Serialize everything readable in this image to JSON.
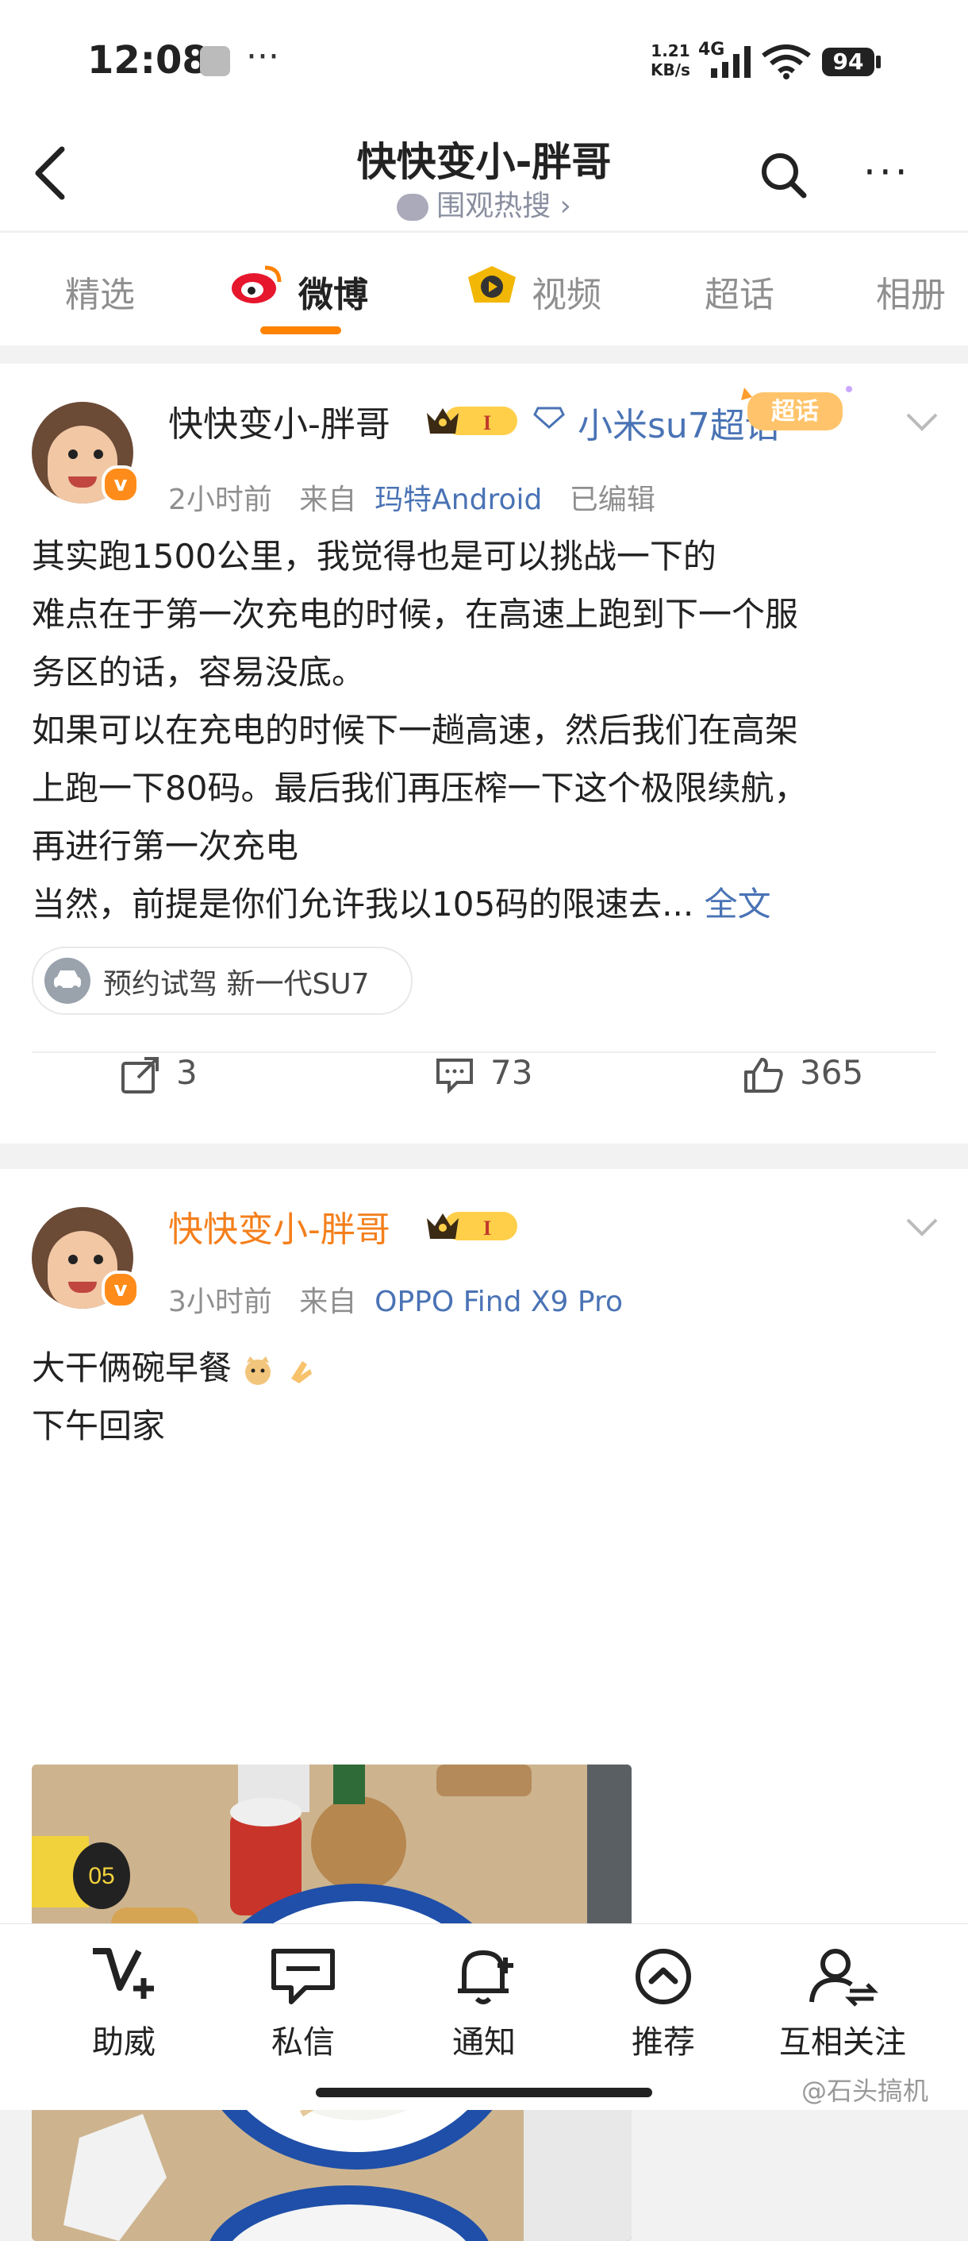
{
  "status_bar": {
    "time": "12:08",
    "dots": "···",
    "net_speed_value": "1.21",
    "net_speed_unit": "KB/s",
    "net_type": "4G",
    "battery": "94"
  },
  "header": {
    "title": "快快变小-胖哥",
    "subtitle": "围观热搜",
    "subtitle_arrow": "›",
    "more": "···"
  },
  "tabs": [
    {
      "label": "精选",
      "active": false
    },
    {
      "label": "微博",
      "active": true
    },
    {
      "label": "视频",
      "active": false
    },
    {
      "label": "超话",
      "active": false
    },
    {
      "label": "相册",
      "active": false
    }
  ],
  "posts": [
    {
      "name": "快快变小-胖哥",
      "member_level": "I",
      "super_topic": "小米su7超话",
      "super_tag": "超话",
      "time": "2小时前",
      "from_prefix": "来自",
      "device": "玛特Android",
      "edited": "已编辑",
      "lines": [
        "其实跑1500公里，我觉得也是可以挑战一下的",
        "难点在于第一次充电的时候，在高速上跑到下一个服",
        "务区的话，容易没底。",
        "如果可以在充电的时候下一趟高速，然后我们在高架",
        "上跑一下80码。最后我们再压榨一下这个极限续航，",
        "再进行第一次充电",
        "当然，前提是你们允许我以105码的限速去..."
      ],
      "full_text_link": "全文",
      "test_drive_pill": "预约试驾 新一代SU7",
      "reposts": "3",
      "comments": "73",
      "likes": "365"
    },
    {
      "name": "快快变小-胖哥",
      "member_level": "I",
      "time": "3小时前",
      "from_prefix": "来自",
      "device": "OPPO Find X9 Pro",
      "lines": [
        "大干俩碗早餐",
        "下午回家"
      ],
      "photo_table_number": "05"
    }
  ],
  "bottom_nav": [
    {
      "label": "助威",
      "icon": "cheer-icon"
    },
    {
      "label": "私信",
      "icon": "message-icon"
    },
    {
      "label": "通知",
      "icon": "bell-icon"
    },
    {
      "label": "推荐",
      "icon": "recommend-icon"
    },
    {
      "label": "互相关注",
      "icon": "mutual-follow-icon"
    }
  ],
  "watermark": "@石头搞机",
  "colors": {
    "accent": "#ff8200",
    "link": "#4a73b5",
    "name_orange": "#f47f1b"
  }
}
